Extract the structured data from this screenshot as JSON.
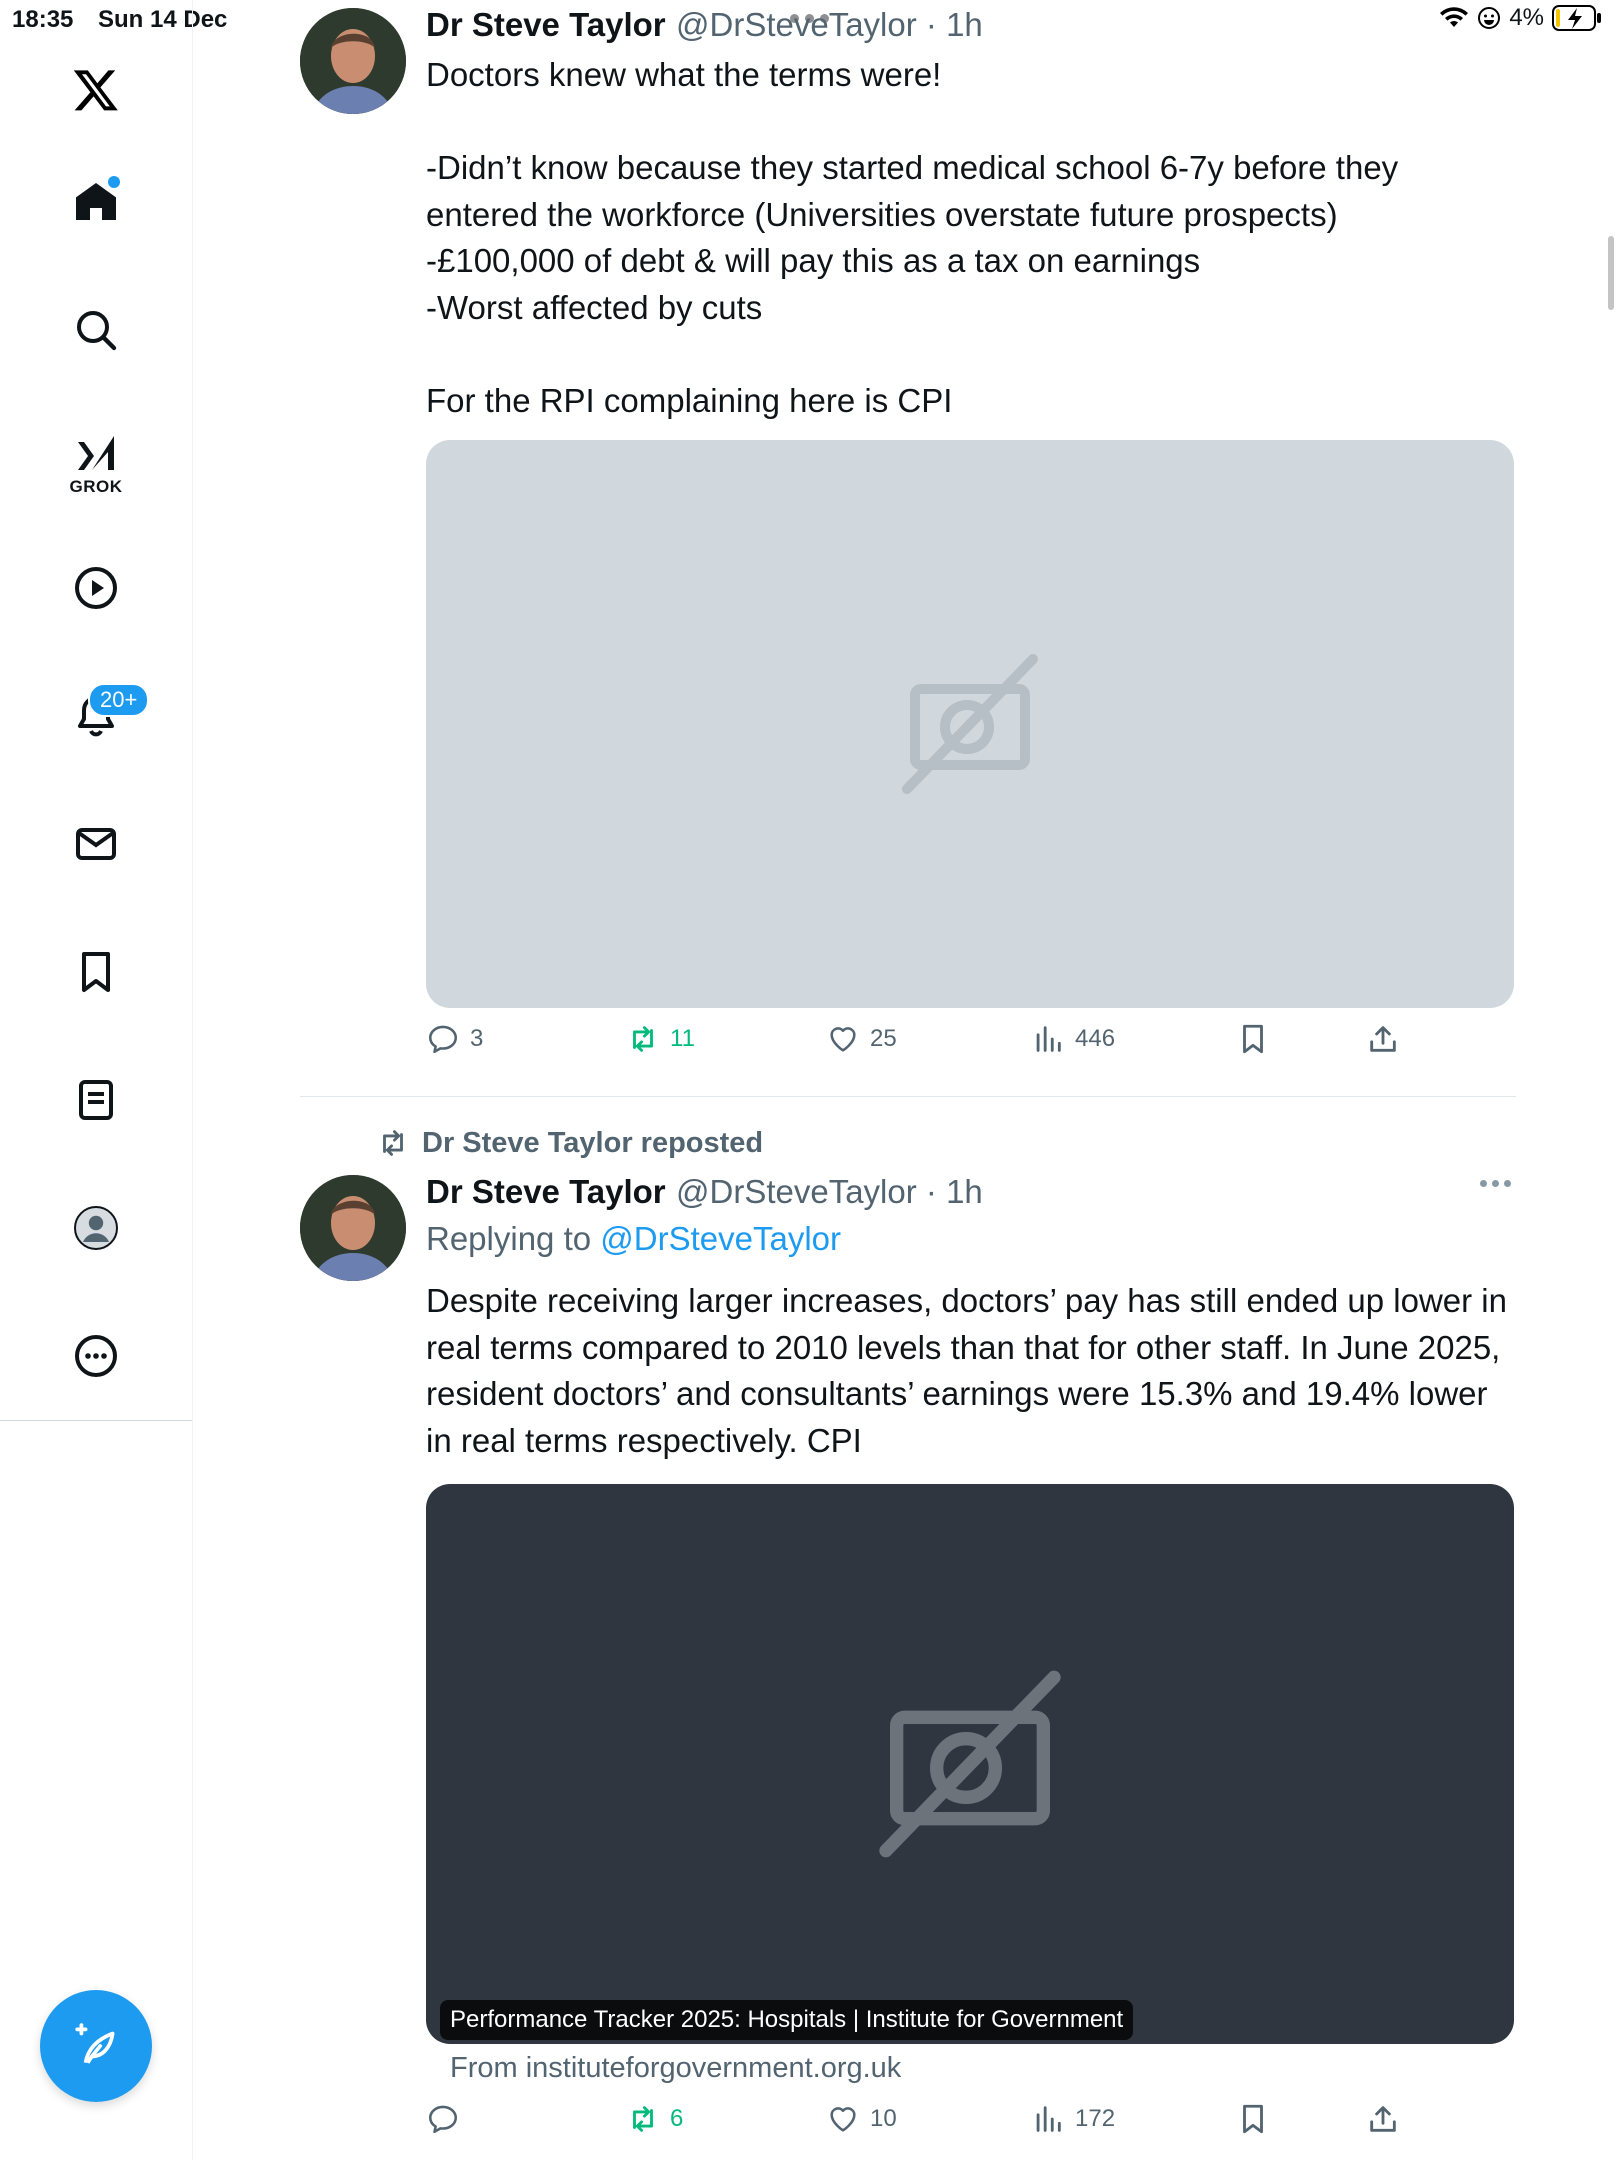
{
  "status_bar": {
    "time": "18:35",
    "date": "Sun 14 Dec",
    "battery": "4%"
  },
  "sidebar": {
    "grok_label": "GROK",
    "notifications_badge": "20+"
  },
  "tweets": [
    {
      "name": "Dr Steve Taylor",
      "handle": "@DrSteveTaylor",
      "time": "1h",
      "text": "Doctors knew what the terms were!\n\n-Didn’t know because they started medical school 6-7y before they entered the workforce (Universities overstate future prospects)\n-£100,000 of debt & will pay this as a tax on earnings\n-Worst affected by cuts\n\nFor the RPI complaining here is CPI",
      "replies": "3",
      "reposts": "11",
      "likes": "25",
      "views": "446"
    },
    {
      "repost_label": "Dr Steve Taylor reposted",
      "name": "Dr Steve Taylor",
      "handle": "@DrSteveTaylor",
      "time": "1h",
      "replying_prefix": "Replying to",
      "replying_to": "@DrSteveTaylor",
      "text": "Despite receiving larger increases, doctors’ pay has still ended up lower in real terms compared to 2010 levels than that for other staff. In June 2025, resident doctors’ and consultants’ earnings were 15.3% and 19.4% lower in real terms respectively. CPI",
      "card_caption": "Performance Tracker 2025: Hospitals | Institute for Government",
      "card_source": "From instituteforgovernment.org.uk",
      "replies": "",
      "reposts": "6",
      "likes": "10",
      "views": "172"
    }
  ],
  "colors": {
    "accent": "#1d9bf0",
    "repost_green": "#00ba7c",
    "muted": "#536471"
  }
}
